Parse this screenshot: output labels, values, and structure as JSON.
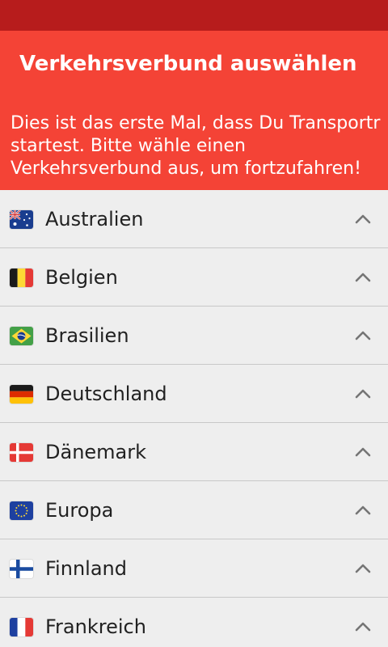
{
  "header": {
    "title": "Verkehrsverbund auswählen",
    "intro": "Dies ist das erste Mal, dass Du Transportr startest. Bitte wähle einen Verkehrsverbund aus, um fortzufahren!"
  },
  "colors": {
    "status_bar": "#b71c1c",
    "header": "#f44336",
    "list_background": "#eeeeee"
  },
  "countries": [
    {
      "name": "Australien",
      "flag": "australia-flag-icon",
      "icon": "chevron-up-icon"
    },
    {
      "name": "Belgien",
      "flag": "belgium-flag-icon",
      "icon": "chevron-up-icon"
    },
    {
      "name": "Brasilien",
      "flag": "brazil-flag-icon",
      "icon": "chevron-up-icon"
    },
    {
      "name": "Deutschland",
      "flag": "germany-flag-icon",
      "icon": "chevron-up-icon"
    },
    {
      "name": "Dänemark",
      "flag": "denmark-flag-icon",
      "icon": "chevron-up-icon"
    },
    {
      "name": "Europa",
      "flag": "europe-flag-icon",
      "icon": "chevron-up-icon"
    },
    {
      "name": "Finnland",
      "flag": "finland-flag-icon",
      "icon": "chevron-up-icon"
    },
    {
      "name": "Frankreich",
      "flag": "france-flag-icon",
      "icon": "chevron-up-icon"
    }
  ]
}
